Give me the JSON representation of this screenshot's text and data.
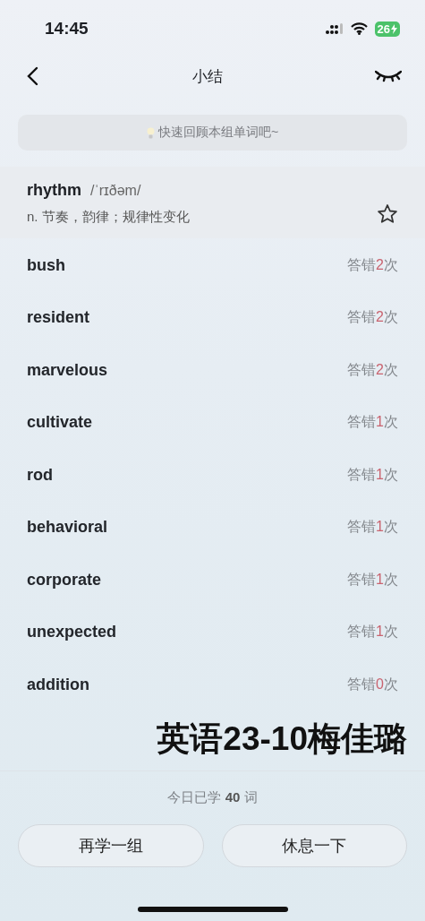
{
  "status_bar": {
    "time": "14:45",
    "battery": "26"
  },
  "nav": {
    "title": "小结"
  },
  "tip": {
    "text": "快速回顾本组单词吧~"
  },
  "featured_word": {
    "word": "rhythm",
    "phonetic": "/ˈrɪðəm/",
    "definition": "n. 节奏，韵律；规律性变化",
    "starred": false
  },
  "words": [
    {
      "word": "bush",
      "wrong": {
        "prefix": "答错",
        "count": "2",
        "suffix": "次"
      }
    },
    {
      "word": "resident",
      "wrong": {
        "prefix": "答错",
        "count": "2",
        "suffix": "次"
      }
    },
    {
      "word": "marvelous",
      "wrong": {
        "prefix": "答错",
        "count": "2",
        "suffix": "次"
      }
    },
    {
      "word": "cultivate",
      "wrong": {
        "prefix": "答错",
        "count": "1",
        "suffix": "次"
      }
    },
    {
      "word": "rod",
      "wrong": {
        "prefix": "答错",
        "count": "1",
        "suffix": "次"
      }
    },
    {
      "word": "behavioral",
      "wrong": {
        "prefix": "答错",
        "count": "1",
        "suffix": "次"
      }
    },
    {
      "word": "corporate",
      "wrong": {
        "prefix": "答错",
        "count": "1",
        "suffix": "次"
      }
    },
    {
      "word": "unexpected",
      "wrong": {
        "prefix": "答错",
        "count": "1",
        "suffix": "次"
      }
    },
    {
      "word": "addition",
      "wrong": {
        "prefix": "答错",
        "count": "0",
        "suffix": "次"
      }
    }
  ],
  "overlay_caption": "英语23-10梅佳璐",
  "footer": {
    "summary": "今日已学 **40** 词",
    "buttons": [
      "再学一组",
      "休息一下"
    ]
  }
}
